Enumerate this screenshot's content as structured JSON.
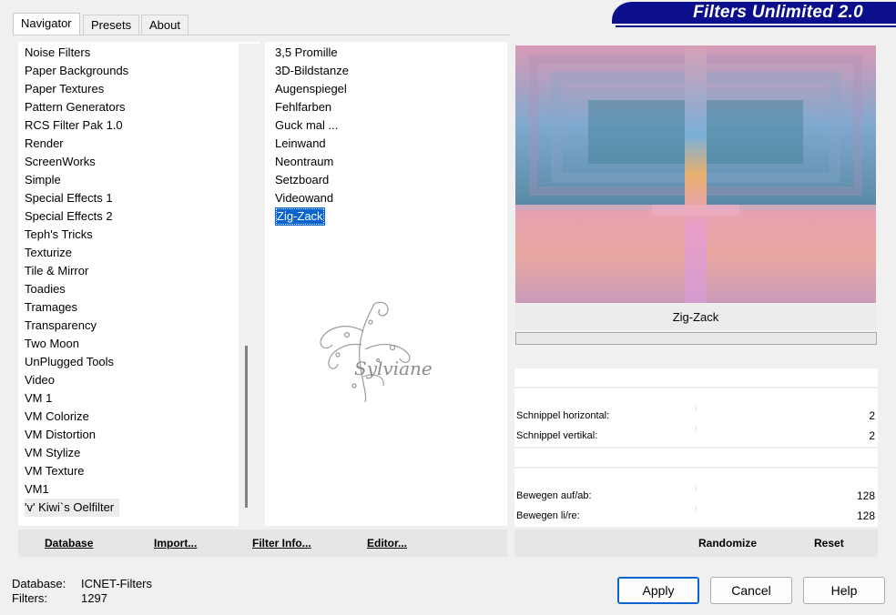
{
  "tabs": [
    {
      "label": "Navigator",
      "active": true
    },
    {
      "label": "Presets",
      "active": false
    },
    {
      "label": "About",
      "active": false
    }
  ],
  "banner": {
    "title": "Filters Unlimited 2.0",
    "color": "#0b0f8c"
  },
  "categories": [
    "Noise Filters",
    "Paper Backgrounds",
    "Paper Textures",
    "Pattern Generators",
    "RCS Filter Pak 1.0",
    "Render",
    "ScreenWorks",
    "Simple",
    "Special Effects 1",
    "Special Effects 2",
    "Teph's Tricks",
    "Texturize",
    "Tile & Mirror",
    "Toadies",
    "Tramages",
    "Transparency",
    "Two Moon",
    "UnPlugged Tools",
    "Video",
    "VM 1",
    "VM Colorize",
    "VM Distortion",
    "VM Stylize",
    "VM Texture",
    "VM1",
    "'v' Kiwi`s Oelfilter"
  ],
  "highlighted_category": "'v' Kiwi`s Oelfilter",
  "filters": [
    "3,5 Promille",
    "3D-Bildstanze",
    "Augenspiegel",
    "Fehlfarben",
    "Guck mal ...",
    "Leinwand",
    "Neontraum",
    "Setzboard",
    "Videowand",
    "Zig-Zack"
  ],
  "selected_filter": "Zig-Zack",
  "watermark_text": "Sylviane",
  "left_toolbar": {
    "database": "Database",
    "import": "Import...",
    "filter_info": "Filter Info...",
    "editor": "Editor..."
  },
  "preview": {
    "filter_name": "Zig-Zack"
  },
  "params": [
    {
      "label": "Schnippel horizontal:",
      "value": "2"
    },
    {
      "label": "Schnippel vertikal:",
      "value": "2"
    },
    {
      "label": "Bewegen auf/ab:",
      "value": "128"
    },
    {
      "label": "Bewegen li/re:",
      "value": "128"
    }
  ],
  "right_toolbar": {
    "randomize": "Randomize",
    "reset": "Reset"
  },
  "status": {
    "database_label": "Database:",
    "database_value": "ICNET-Filters",
    "filters_label": "Filters:",
    "filters_value": "1297"
  },
  "buttons": {
    "apply": "Apply",
    "cancel": "Cancel",
    "help": "Help"
  },
  "colors": {
    "selection": "#0a64d0",
    "window": "#f0f0f0"
  }
}
